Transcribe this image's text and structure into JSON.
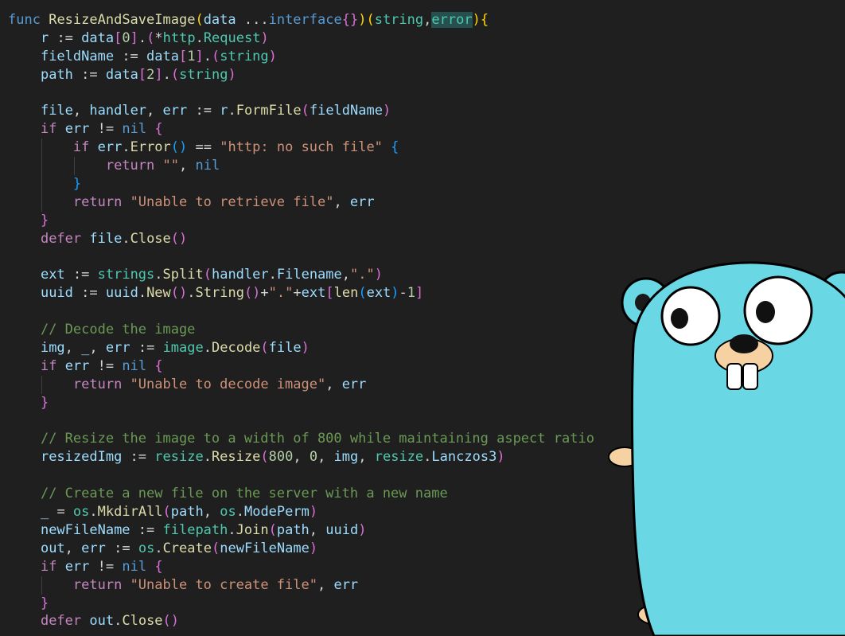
{
  "colors": {
    "background": "#1f1f1f",
    "plain": "#d4d4d4",
    "keyword": "#c586c0",
    "declaration": "#569cd6",
    "function": "#dcdcaa",
    "type": "#4ec9b0",
    "variable": "#9cdcfe",
    "string": "#ce9178",
    "number": "#b5cea8",
    "comment": "#6a9955",
    "bracket_gold": "#ffd700",
    "bracket_pink": "#da70d6",
    "bracket_blue": "#179fff",
    "highlight": "#264f4f"
  },
  "code": [
    {
      "indent": 0,
      "tokens": [
        [
          "func",
          "declaration"
        ],
        [
          " ",
          "plain"
        ],
        [
          "ResizeAndSaveImage",
          "function"
        ],
        [
          "(",
          "bracket_gold"
        ],
        [
          "data",
          "variable"
        ],
        [
          " ...",
          "plain"
        ],
        [
          "interface",
          "declaration"
        ],
        [
          "{}",
          "bracket_pink"
        ],
        [
          ")",
          "bracket_gold"
        ],
        [
          "(",
          "bracket_gold"
        ],
        [
          "string",
          "type"
        ],
        [
          ",",
          "plain"
        ],
        [
          "error",
          "type",
          "highlight"
        ],
        [
          ")",
          "bracket_gold"
        ],
        [
          "{",
          "bracket_gold"
        ]
      ]
    },
    {
      "indent": 1,
      "tokens": [
        [
          "r",
          "variable"
        ],
        [
          " := ",
          "plain"
        ],
        [
          "data",
          "variable"
        ],
        [
          "[",
          "bracket_pink"
        ],
        [
          "0",
          "number"
        ],
        [
          "]",
          "bracket_pink"
        ],
        [
          ".",
          "plain"
        ],
        [
          "(",
          "bracket_pink"
        ],
        [
          "*",
          "plain"
        ],
        [
          "http",
          "type"
        ],
        [
          ".",
          "plain"
        ],
        [
          "Request",
          "type"
        ],
        [
          ")",
          "bracket_pink"
        ]
      ]
    },
    {
      "indent": 1,
      "tokens": [
        [
          "fieldName",
          "variable"
        ],
        [
          " := ",
          "plain"
        ],
        [
          "data",
          "variable"
        ],
        [
          "[",
          "bracket_pink"
        ],
        [
          "1",
          "number"
        ],
        [
          "]",
          "bracket_pink"
        ],
        [
          ".",
          "plain"
        ],
        [
          "(",
          "bracket_pink"
        ],
        [
          "string",
          "type"
        ],
        [
          ")",
          "bracket_pink"
        ]
      ]
    },
    {
      "indent": 1,
      "tokens": [
        [
          "path",
          "variable"
        ],
        [
          " := ",
          "plain"
        ],
        [
          "data",
          "variable"
        ],
        [
          "[",
          "bracket_pink"
        ],
        [
          "2",
          "number"
        ],
        [
          "]",
          "bracket_pink"
        ],
        [
          ".",
          "plain"
        ],
        [
          "(",
          "bracket_pink"
        ],
        [
          "string",
          "type"
        ],
        [
          ")",
          "bracket_pink"
        ]
      ]
    },
    {
      "indent": 1,
      "tokens": []
    },
    {
      "indent": 1,
      "tokens": [
        [
          "file",
          "variable"
        ],
        [
          ", ",
          "plain"
        ],
        [
          "handler",
          "variable"
        ],
        [
          ", ",
          "plain"
        ],
        [
          "err",
          "variable"
        ],
        [
          " := ",
          "plain"
        ],
        [
          "r",
          "variable"
        ],
        [
          ".",
          "plain"
        ],
        [
          "FormFile",
          "function"
        ],
        [
          "(",
          "bracket_pink"
        ],
        [
          "fieldName",
          "variable"
        ],
        [
          ")",
          "bracket_pink"
        ]
      ]
    },
    {
      "indent": 1,
      "tokens": [
        [
          "if",
          "keyword"
        ],
        [
          " ",
          "plain"
        ],
        [
          "err",
          "variable"
        ],
        [
          " != ",
          "plain"
        ],
        [
          "nil",
          "declaration"
        ],
        [
          " ",
          "plain"
        ],
        [
          "{",
          "bracket_pink"
        ]
      ]
    },
    {
      "indent": 2,
      "tokens": [
        [
          "if",
          "keyword"
        ],
        [
          " ",
          "plain"
        ],
        [
          "err",
          "variable"
        ],
        [
          ".",
          "plain"
        ],
        [
          "Error",
          "function"
        ],
        [
          "()",
          "bracket_blue"
        ],
        [
          " == ",
          "plain"
        ],
        [
          "\"http: no such file\"",
          "string"
        ],
        [
          " ",
          "plain"
        ],
        [
          "{",
          "bracket_blue"
        ]
      ]
    },
    {
      "indent": 3,
      "tokens": [
        [
          "return",
          "keyword"
        ],
        [
          " ",
          "plain"
        ],
        [
          "\"\"",
          "string"
        ],
        [
          ", ",
          "plain"
        ],
        [
          "nil",
          "declaration"
        ]
      ]
    },
    {
      "indent": 2,
      "tokens": [
        [
          "}",
          "bracket_blue"
        ]
      ]
    },
    {
      "indent": 2,
      "tokens": [
        [
          "return",
          "keyword"
        ],
        [
          " ",
          "plain"
        ],
        [
          "\"Unable to retrieve file\"",
          "string"
        ],
        [
          ", ",
          "plain"
        ],
        [
          "err",
          "variable"
        ]
      ]
    },
    {
      "indent": 1,
      "tokens": [
        [
          "}",
          "bracket_pink"
        ]
      ]
    },
    {
      "indent": 1,
      "tokens": [
        [
          "defer",
          "keyword"
        ],
        [
          " ",
          "plain"
        ],
        [
          "file",
          "variable"
        ],
        [
          ".",
          "plain"
        ],
        [
          "Close",
          "function"
        ],
        [
          "()",
          "bracket_pink"
        ]
      ]
    },
    {
      "indent": 1,
      "tokens": []
    },
    {
      "indent": 1,
      "tokens": [
        [
          "ext",
          "variable"
        ],
        [
          " := ",
          "plain"
        ],
        [
          "strings",
          "type"
        ],
        [
          ".",
          "plain"
        ],
        [
          "Split",
          "function"
        ],
        [
          "(",
          "bracket_pink"
        ],
        [
          "handler",
          "variable"
        ],
        [
          ".",
          "plain"
        ],
        [
          "Filename",
          "variable"
        ],
        [
          ",",
          "plain"
        ],
        [
          "\".\"",
          "string"
        ],
        [
          ")",
          "bracket_pink"
        ]
      ]
    },
    {
      "indent": 1,
      "tokens": [
        [
          "uuid",
          "variable"
        ],
        [
          " := ",
          "plain"
        ],
        [
          "uuid",
          "variable"
        ],
        [
          ".",
          "plain"
        ],
        [
          "New",
          "function"
        ],
        [
          "()",
          "bracket_pink"
        ],
        [
          ".",
          "plain"
        ],
        [
          "String",
          "function"
        ],
        [
          "()",
          "bracket_pink"
        ],
        [
          "+",
          "plain"
        ],
        [
          "\".\"",
          "string"
        ],
        [
          "+",
          "plain"
        ],
        [
          "ext",
          "variable"
        ],
        [
          "[",
          "bracket_pink"
        ],
        [
          "len",
          "function"
        ],
        [
          "(",
          "bracket_blue"
        ],
        [
          "ext",
          "variable"
        ],
        [
          ")",
          "bracket_blue"
        ],
        [
          "-",
          "plain"
        ],
        [
          "1",
          "number"
        ],
        [
          "]",
          "bracket_pink"
        ]
      ]
    },
    {
      "indent": 1,
      "tokens": []
    },
    {
      "indent": 1,
      "tokens": [
        [
          "// Decode the image",
          "comment"
        ]
      ]
    },
    {
      "indent": 1,
      "tokens": [
        [
          "img",
          "variable"
        ],
        [
          ", ",
          "plain"
        ],
        [
          "_",
          "variable"
        ],
        [
          ", ",
          "plain"
        ],
        [
          "err",
          "variable"
        ],
        [
          " := ",
          "plain"
        ],
        [
          "image",
          "type"
        ],
        [
          ".",
          "plain"
        ],
        [
          "Decode",
          "function"
        ],
        [
          "(",
          "bracket_pink"
        ],
        [
          "file",
          "variable"
        ],
        [
          ")",
          "bracket_pink"
        ]
      ]
    },
    {
      "indent": 1,
      "tokens": [
        [
          "if",
          "keyword"
        ],
        [
          " ",
          "plain"
        ],
        [
          "err",
          "variable"
        ],
        [
          " != ",
          "plain"
        ],
        [
          "nil",
          "declaration"
        ],
        [
          " ",
          "plain"
        ],
        [
          "{",
          "bracket_pink"
        ]
      ]
    },
    {
      "indent": 2,
      "tokens": [
        [
          "return",
          "keyword"
        ],
        [
          " ",
          "plain"
        ],
        [
          "\"Unable to decode image\"",
          "string"
        ],
        [
          ", ",
          "plain"
        ],
        [
          "err",
          "variable"
        ]
      ]
    },
    {
      "indent": 1,
      "tokens": [
        [
          "}",
          "bracket_pink"
        ]
      ]
    },
    {
      "indent": 1,
      "tokens": []
    },
    {
      "indent": 1,
      "tokens": [
        [
          "// Resize the image to a width of 800 while maintaining aspect ratio",
          "comment"
        ]
      ]
    },
    {
      "indent": 1,
      "tokens": [
        [
          "resizedImg",
          "variable"
        ],
        [
          " := ",
          "plain"
        ],
        [
          "resize",
          "type"
        ],
        [
          ".",
          "plain"
        ],
        [
          "Resize",
          "function"
        ],
        [
          "(",
          "bracket_pink"
        ],
        [
          "800",
          "number"
        ],
        [
          ", ",
          "plain"
        ],
        [
          "0",
          "number"
        ],
        [
          ", ",
          "plain"
        ],
        [
          "img",
          "variable"
        ],
        [
          ", ",
          "plain"
        ],
        [
          "resize",
          "type"
        ],
        [
          ".",
          "plain"
        ],
        [
          "Lanczos3",
          "variable"
        ],
        [
          ")",
          "bracket_pink"
        ]
      ]
    },
    {
      "indent": 1,
      "tokens": []
    },
    {
      "indent": 1,
      "tokens": [
        [
          "// Create a new file on the server with a new name",
          "comment"
        ]
      ]
    },
    {
      "indent": 1,
      "tokens": [
        [
          "_",
          "variable"
        ],
        [
          " = ",
          "plain"
        ],
        [
          "os",
          "type"
        ],
        [
          ".",
          "plain"
        ],
        [
          "MkdirAll",
          "function"
        ],
        [
          "(",
          "bracket_pink"
        ],
        [
          "path",
          "variable"
        ],
        [
          ", ",
          "plain"
        ],
        [
          "os",
          "type"
        ],
        [
          ".",
          "plain"
        ],
        [
          "ModePerm",
          "variable"
        ],
        [
          ")",
          "bracket_pink"
        ]
      ]
    },
    {
      "indent": 1,
      "tokens": [
        [
          "newFileName",
          "variable"
        ],
        [
          " := ",
          "plain"
        ],
        [
          "filepath",
          "type"
        ],
        [
          ".",
          "plain"
        ],
        [
          "Join",
          "function"
        ],
        [
          "(",
          "bracket_pink"
        ],
        [
          "path",
          "variable"
        ],
        [
          ", ",
          "plain"
        ],
        [
          "uuid",
          "variable"
        ],
        [
          ")",
          "bracket_pink"
        ]
      ]
    },
    {
      "indent": 1,
      "tokens": [
        [
          "out",
          "variable"
        ],
        [
          ", ",
          "plain"
        ],
        [
          "err",
          "variable"
        ],
        [
          " := ",
          "plain"
        ],
        [
          "os",
          "type"
        ],
        [
          ".",
          "plain"
        ],
        [
          "Create",
          "function"
        ],
        [
          "(",
          "bracket_pink"
        ],
        [
          "newFileName",
          "variable"
        ],
        [
          ")",
          "bracket_pink"
        ]
      ]
    },
    {
      "indent": 1,
      "tokens": [
        [
          "if",
          "keyword"
        ],
        [
          " ",
          "plain"
        ],
        [
          "err",
          "variable"
        ],
        [
          " != ",
          "plain"
        ],
        [
          "nil",
          "declaration"
        ],
        [
          " ",
          "plain"
        ],
        [
          "{",
          "bracket_pink"
        ]
      ]
    },
    {
      "indent": 2,
      "tokens": [
        [
          "return",
          "keyword"
        ],
        [
          " ",
          "plain"
        ],
        [
          "\"Unable to create file\"",
          "string"
        ],
        [
          ", ",
          "plain"
        ],
        [
          "err",
          "variable"
        ]
      ]
    },
    {
      "indent": 1,
      "tokens": [
        [
          "}",
          "bracket_pink"
        ]
      ]
    },
    {
      "indent": 1,
      "tokens": [
        [
          "defer",
          "keyword"
        ],
        [
          " ",
          "plain"
        ],
        [
          "out",
          "variable"
        ],
        [
          ".",
          "plain"
        ],
        [
          "Close",
          "function"
        ],
        [
          "()",
          "bracket_pink"
        ]
      ]
    }
  ],
  "mascot": {
    "icon": "go-gopher-icon",
    "body_color": "#6ad7e5",
    "skin_color": "#f6d2a2"
  }
}
